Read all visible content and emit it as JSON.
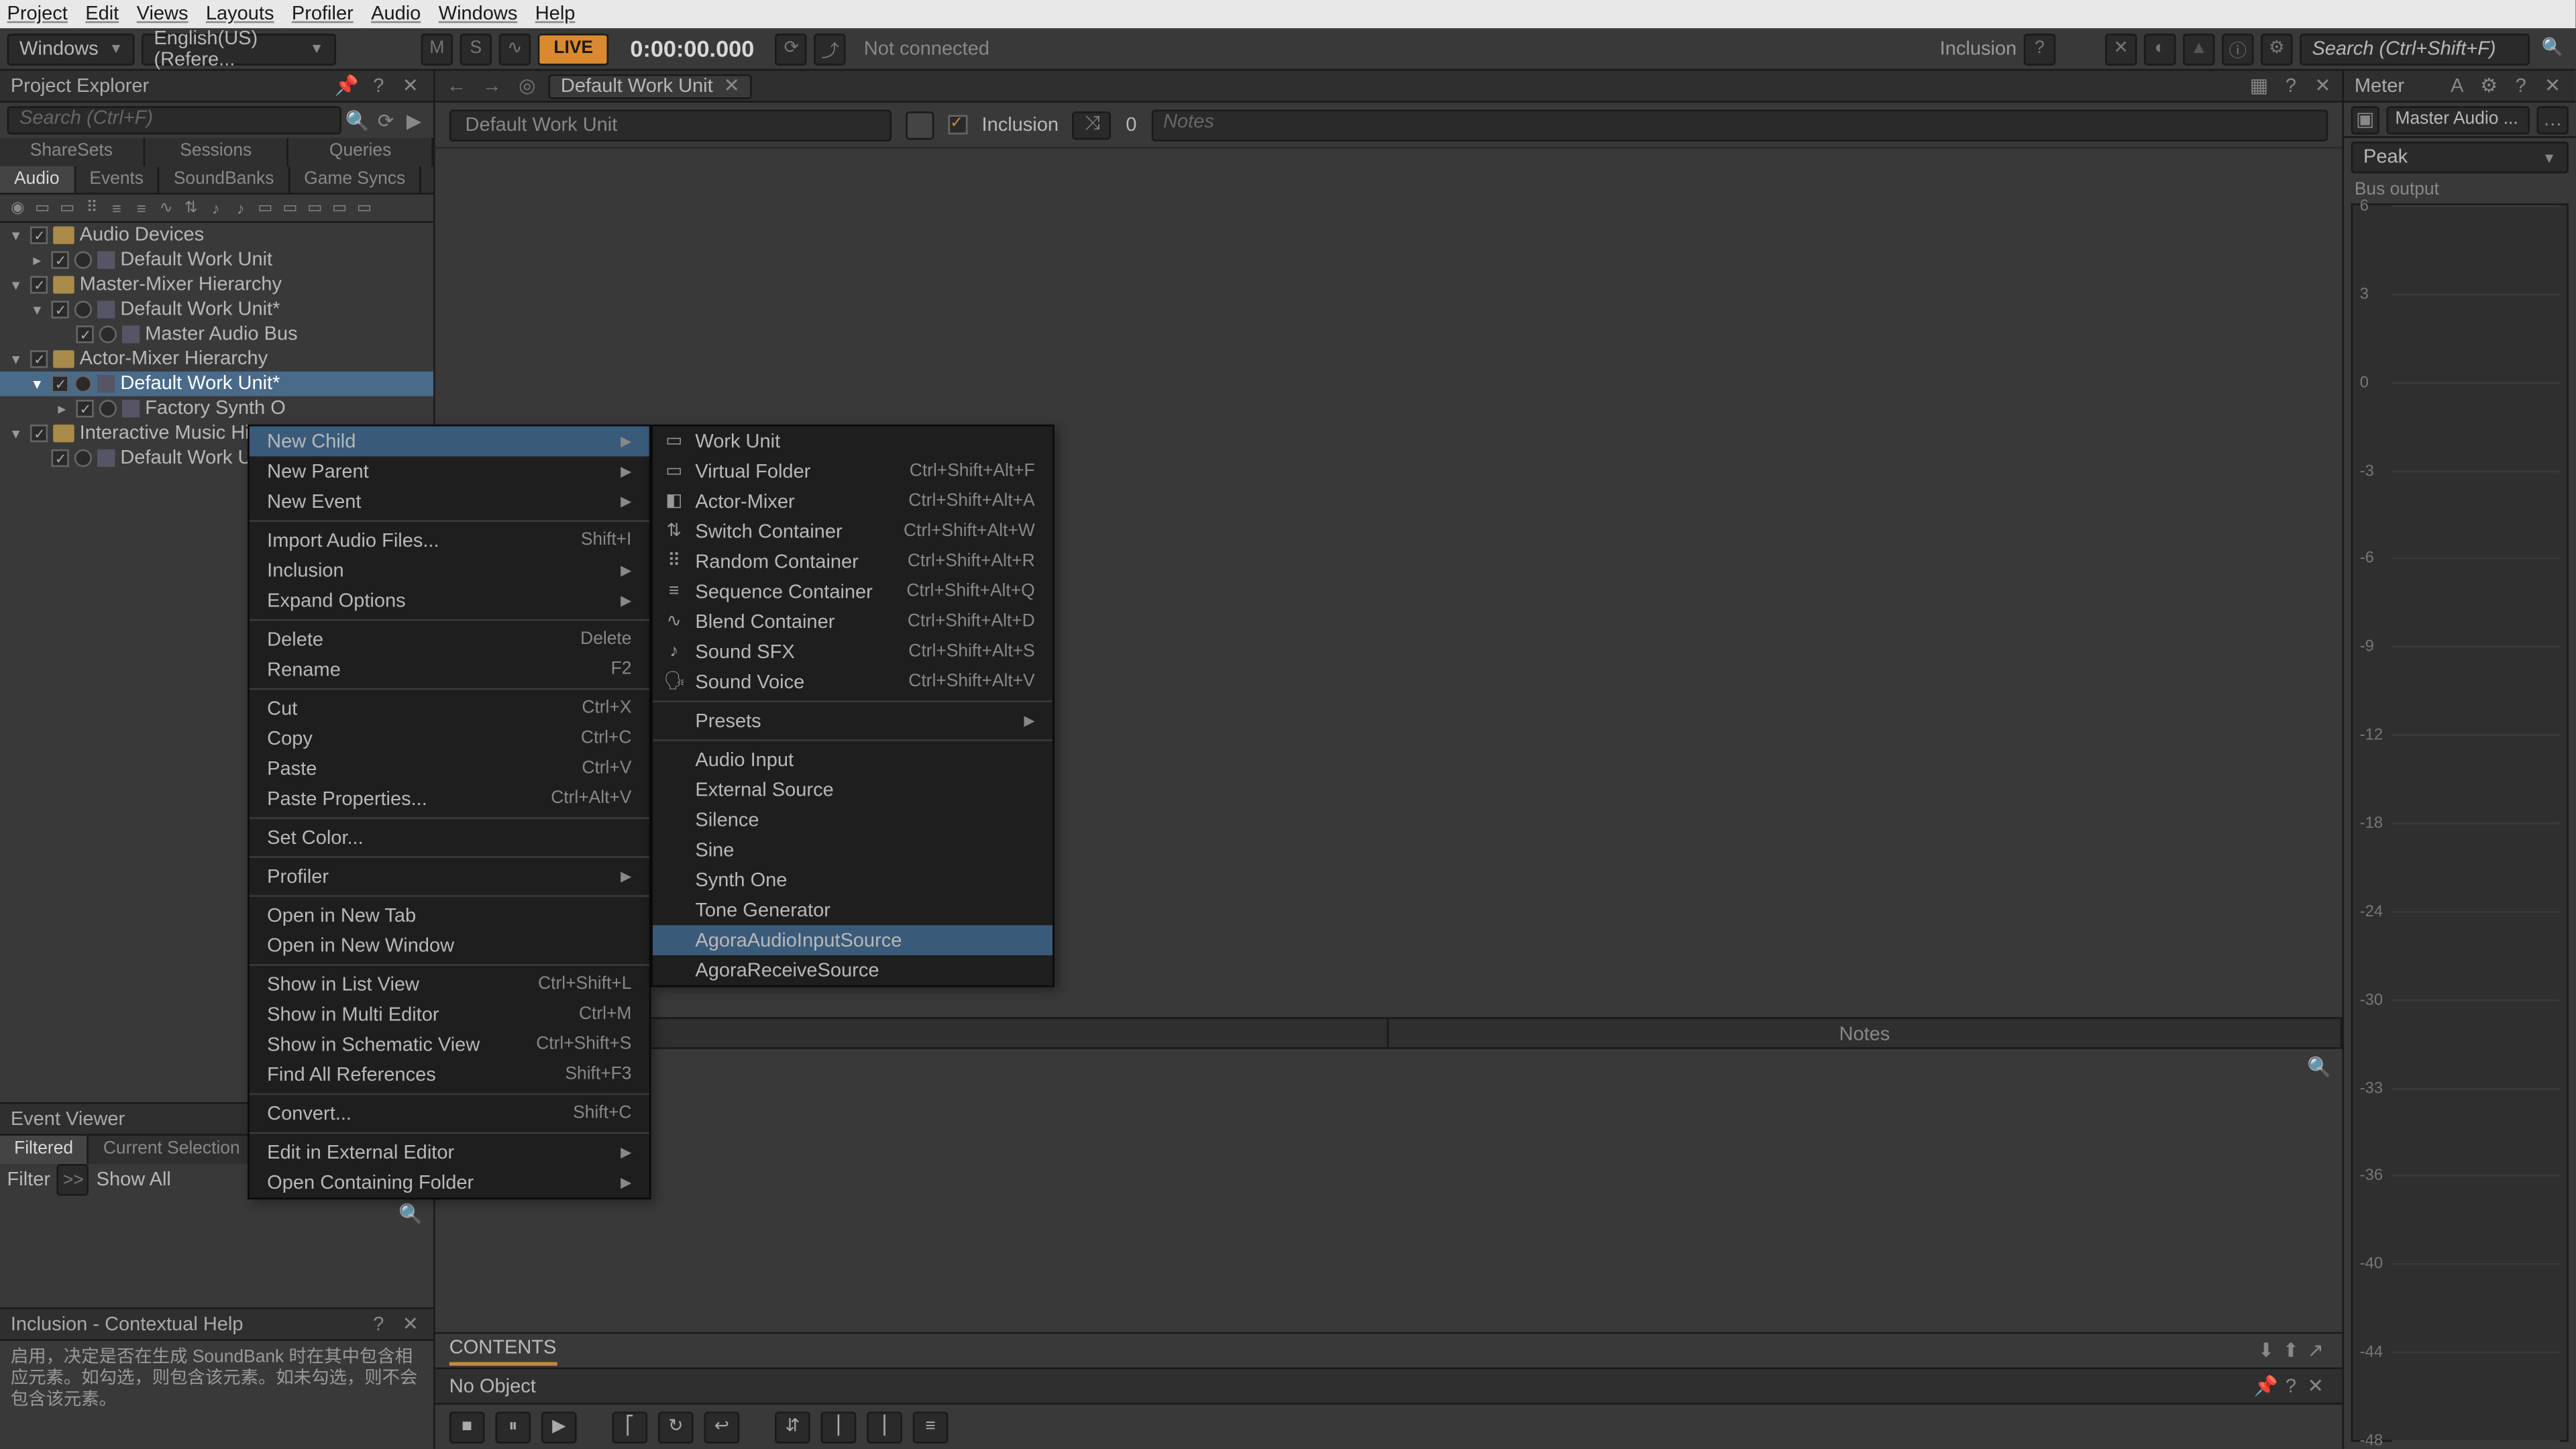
{
  "menubar": [
    "Project",
    "Edit",
    "Views",
    "Layouts",
    "Profiler",
    "Audio",
    "Windows",
    "Help"
  ],
  "toolbar": {
    "layout_combo": "Windows",
    "lang_combo": "English(US) (Refere...",
    "m": "M",
    "s": "S",
    "live": "LIVE",
    "timecode": "0:00:00.000",
    "status": "Not connected",
    "inclusion": "Inclusion",
    "search_ph": "Search (Ctrl+Shift+F)"
  },
  "project_explorer": {
    "title": "Project Explorer",
    "search_ph": "Search (Ctrl+F)",
    "tabs1": [
      "ShareSets",
      "Sessions",
      "Queries"
    ],
    "tabs2": [
      "Audio",
      "Events",
      "SoundBanks",
      "Game Syncs"
    ],
    "tree": [
      {
        "lvl": 0,
        "tw": "v",
        "label": "Audio Devices",
        "kind": "folder"
      },
      {
        "lvl": 1,
        "tw": ">",
        "label": "Default Work Unit",
        "kind": "wu"
      },
      {
        "lvl": 0,
        "tw": "v",
        "label": "Master-Mixer Hierarchy",
        "kind": "folder"
      },
      {
        "lvl": 1,
        "tw": "v",
        "label": "Default Work Unit*",
        "kind": "wu"
      },
      {
        "lvl": 2,
        "tw": "",
        "label": "Master Audio Bus",
        "kind": "bus"
      },
      {
        "lvl": 0,
        "tw": "v",
        "label": "Actor-Mixer Hierarchy",
        "kind": "folder"
      },
      {
        "lvl": 1,
        "tw": "v",
        "label": "Default Work Unit*",
        "kind": "wu",
        "sel": true
      },
      {
        "lvl": 2,
        "tw": ">",
        "label": "Factory Synth O",
        "kind": "node"
      },
      {
        "lvl": 0,
        "tw": "v",
        "label": "Interactive Music Hiera",
        "kind": "folder"
      },
      {
        "lvl": 1,
        "tw": "",
        "label": "Default Work U",
        "kind": "wu"
      }
    ]
  },
  "ctx1": [
    {
      "label": "New Child",
      "arrow": true,
      "hl": true
    },
    {
      "label": "New Parent",
      "arrow": true,
      "dis": true
    },
    {
      "label": "New Event",
      "arrow": true,
      "dis": true
    },
    {
      "sep": true
    },
    {
      "label": "Import Audio Files...",
      "sc": "Shift+I"
    },
    {
      "label": "Inclusion",
      "arrow": true
    },
    {
      "label": "Expand Options",
      "arrow": true
    },
    {
      "sep": true
    },
    {
      "label": "Delete",
      "sc": "Delete",
      "dis": true
    },
    {
      "label": "Rename",
      "sc": "F2"
    },
    {
      "sep": true
    },
    {
      "label": "Cut",
      "sc": "Ctrl+X"
    },
    {
      "label": "Copy",
      "sc": "Ctrl+C"
    },
    {
      "label": "Paste",
      "sc": "Ctrl+V"
    },
    {
      "label": "Paste Properties...",
      "sc": "Ctrl+Alt+V"
    },
    {
      "sep": true
    },
    {
      "label": "Set Color..."
    },
    {
      "sep": true
    },
    {
      "label": "Profiler",
      "arrow": true
    },
    {
      "sep": true
    },
    {
      "label": "Open in New Tab"
    },
    {
      "label": "Open in New Window"
    },
    {
      "sep": true
    },
    {
      "label": "Show in List View",
      "sc": "Ctrl+Shift+L"
    },
    {
      "label": "Show in Multi Editor",
      "sc": "Ctrl+M"
    },
    {
      "label": "Show in Schematic View",
      "sc": "Ctrl+Shift+S"
    },
    {
      "label": "Find All References",
      "sc": "Shift+F3"
    },
    {
      "sep": true
    },
    {
      "label": "Convert...",
      "sc": "Shift+C",
      "dis": true
    },
    {
      "sep": true
    },
    {
      "label": "Edit in External Editor",
      "arrow": true
    },
    {
      "label": "Open Containing Folder",
      "arrow": true
    }
  ],
  "ctx2": [
    {
      "ico": "▭",
      "label": "Work Unit"
    },
    {
      "ico": "▭",
      "label": "Virtual Folder",
      "sc": "Ctrl+Shift+Alt+F"
    },
    {
      "ico": "◧",
      "label": "Actor-Mixer",
      "sc": "Ctrl+Shift+Alt+A"
    },
    {
      "ico": "⇅",
      "label": "Switch Container",
      "sc": "Ctrl+Shift+Alt+W"
    },
    {
      "ico": "⠿",
      "label": "Random Container",
      "sc": "Ctrl+Shift+Alt+R"
    },
    {
      "ico": "≡",
      "label": "Sequence Container",
      "sc": "Ctrl+Shift+Alt+Q"
    },
    {
      "ico": "∿",
      "label": "Blend Container",
      "sc": "Ctrl+Shift+Alt+D"
    },
    {
      "ico": "♪",
      "label": "Sound SFX",
      "sc": "Ctrl+Shift+Alt+S"
    },
    {
      "ico": "🗣",
      "label": "Sound Voice",
      "sc": "Ctrl+Shift+Alt+V"
    },
    {
      "sep": true
    },
    {
      "label": "Presets",
      "arrow": true
    },
    {
      "sep": true
    },
    {
      "label": "Audio Input"
    },
    {
      "label": "External Source"
    },
    {
      "label": "Silence"
    },
    {
      "label": "Sine"
    },
    {
      "label": "Synth One"
    },
    {
      "label": "Tone Generator"
    },
    {
      "label": "AgoraAudioInputSource",
      "hl": true
    },
    {
      "label": "AgoraReceiveSource"
    }
  ],
  "event_viewer": {
    "title": "Event Viewer",
    "tabs": [
      "Filtered",
      "Current Selection"
    ],
    "filter_label": "Filter",
    "showall": "Show All"
  },
  "inclusion_help": {
    "title": "Inclusion - Contextual Help",
    "body": "启用，决定是否在生成 SoundBank 时在其中包含相应元素。如勾选，则包含该元素。如未勾选，则不会包含该元素。"
  },
  "center": {
    "tab": "Default Work Unit",
    "name": "Default Work Unit",
    "inclusion_label": "Inclusion",
    "share_count": "0",
    "notes_ph": "Notes",
    "split_tabs": [
      "",
      "Notes"
    ],
    "contents": "CONTENTS",
    "noobj": "No Object"
  },
  "meter": {
    "title": "Meter",
    "mab": "Master Audio ...",
    "peak": "Peak",
    "busout": "Bus output",
    "ticks": [
      "6",
      "3",
      "0",
      "-3",
      "-6",
      "-9",
      "-12",
      "-18",
      "-24",
      "-30",
      "-33",
      "-36",
      "-40",
      "-44",
      "-48"
    ]
  }
}
